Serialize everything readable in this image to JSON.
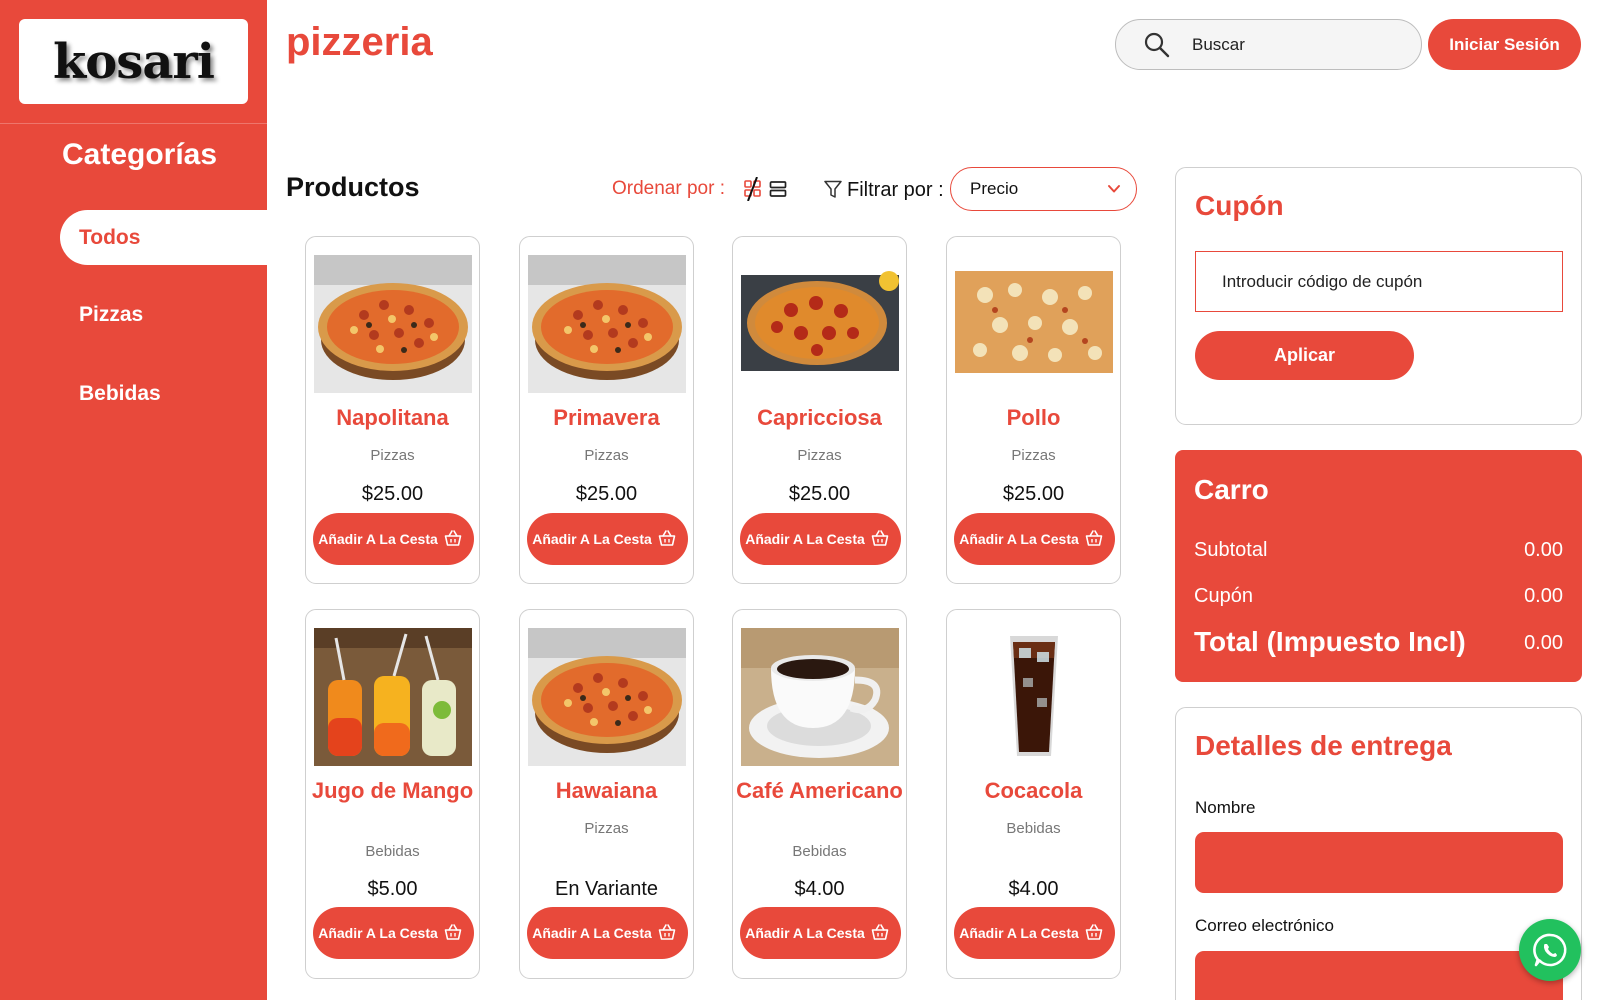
{
  "brand": {
    "logo_text": "kosari",
    "store_name": "pizzeria"
  },
  "header": {
    "search_placeholder": "Buscar",
    "login_label": "Iniciar Sesión"
  },
  "sidebar": {
    "title": "Categorías",
    "items": [
      {
        "label": "Todos",
        "active": true
      },
      {
        "label": "Pizzas",
        "active": false
      },
      {
        "label": "Bebidas",
        "active": false
      }
    ]
  },
  "products_section": {
    "title": "Productos",
    "sort_label": "Ordenar por :",
    "filter_label": "Filtrar por :",
    "filter_value": "Precio"
  },
  "add_to_cart_label": "Añadir A La Cesta",
  "products": [
    {
      "name": "Napolitana",
      "category": "Pizzas",
      "price": "$25.00",
      "image": "pizza-image"
    },
    {
      "name": "Primavera",
      "category": "Pizzas",
      "price": "$25.00",
      "image": "pizza-image"
    },
    {
      "name": "Capricciosa",
      "category": "Pizzas",
      "price": "$25.00",
      "image": "pepperoni-pizza-image"
    },
    {
      "name": "Pollo",
      "category": "Pizzas",
      "price": "$25.00",
      "image": "chicken-pizza-image"
    },
    {
      "name": "Jugo de Mango",
      "category": "Bebidas",
      "price": "$5.00",
      "image": "juice-glasses-image"
    },
    {
      "name": "Hawaiana",
      "category": "Pizzas",
      "price": "En Variante",
      "image": "pizza-image"
    },
    {
      "name": "Café Americano",
      "category": "Bebidas",
      "price": "$4.00",
      "image": "coffee-cup-image"
    },
    {
      "name": "Cocacola",
      "category": "Bebidas",
      "price": "$4.00",
      "image": "cola-glass-image"
    }
  ],
  "coupon": {
    "title": "Cupón",
    "placeholder": "Introducir código de cupón",
    "apply_label": "Aplicar"
  },
  "cart": {
    "title": "Carro",
    "subtotal_label": "Subtotal",
    "subtotal_value": "0.00",
    "coupon_label": "Cupón",
    "coupon_value": "0.00",
    "total_label": "Total (Impuesto Incl)",
    "total_value": "0.00"
  },
  "delivery": {
    "title": "Detalles de entrega",
    "name_label": "Nombre",
    "email_label": "Correo electrónico"
  },
  "colors": {
    "accent": "#e8493b",
    "whatsapp": "#22c15e"
  }
}
